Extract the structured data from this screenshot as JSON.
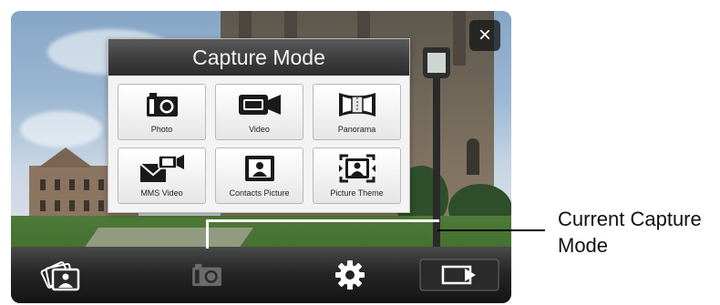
{
  "panel": {
    "title": "Capture Mode",
    "modes": [
      {
        "label": "Photo",
        "icon": "camera-icon"
      },
      {
        "label": "Video",
        "icon": "video-camera-icon"
      },
      {
        "label": "Panorama",
        "icon": "panorama-icon"
      },
      {
        "label": "MMS Video",
        "icon": "mms-video-icon"
      },
      {
        "label": "Contacts Picture",
        "icon": "contacts-picture-icon"
      },
      {
        "label": "Picture Theme",
        "icon": "picture-theme-icon"
      }
    ]
  },
  "close": {
    "label": "×",
    "icon": "close-icon"
  },
  "toolbar": {
    "album_icon": "album-icon",
    "current_mode_icon": "camera-icon",
    "settings_icon": "gear-icon",
    "exit_icon": "exit-icon"
  },
  "callout": {
    "line1": "Current Capture",
    "line2": "Mode"
  },
  "colors": {
    "accent": "#3d3d3d",
    "toolbar": "#1c1c1c"
  }
}
